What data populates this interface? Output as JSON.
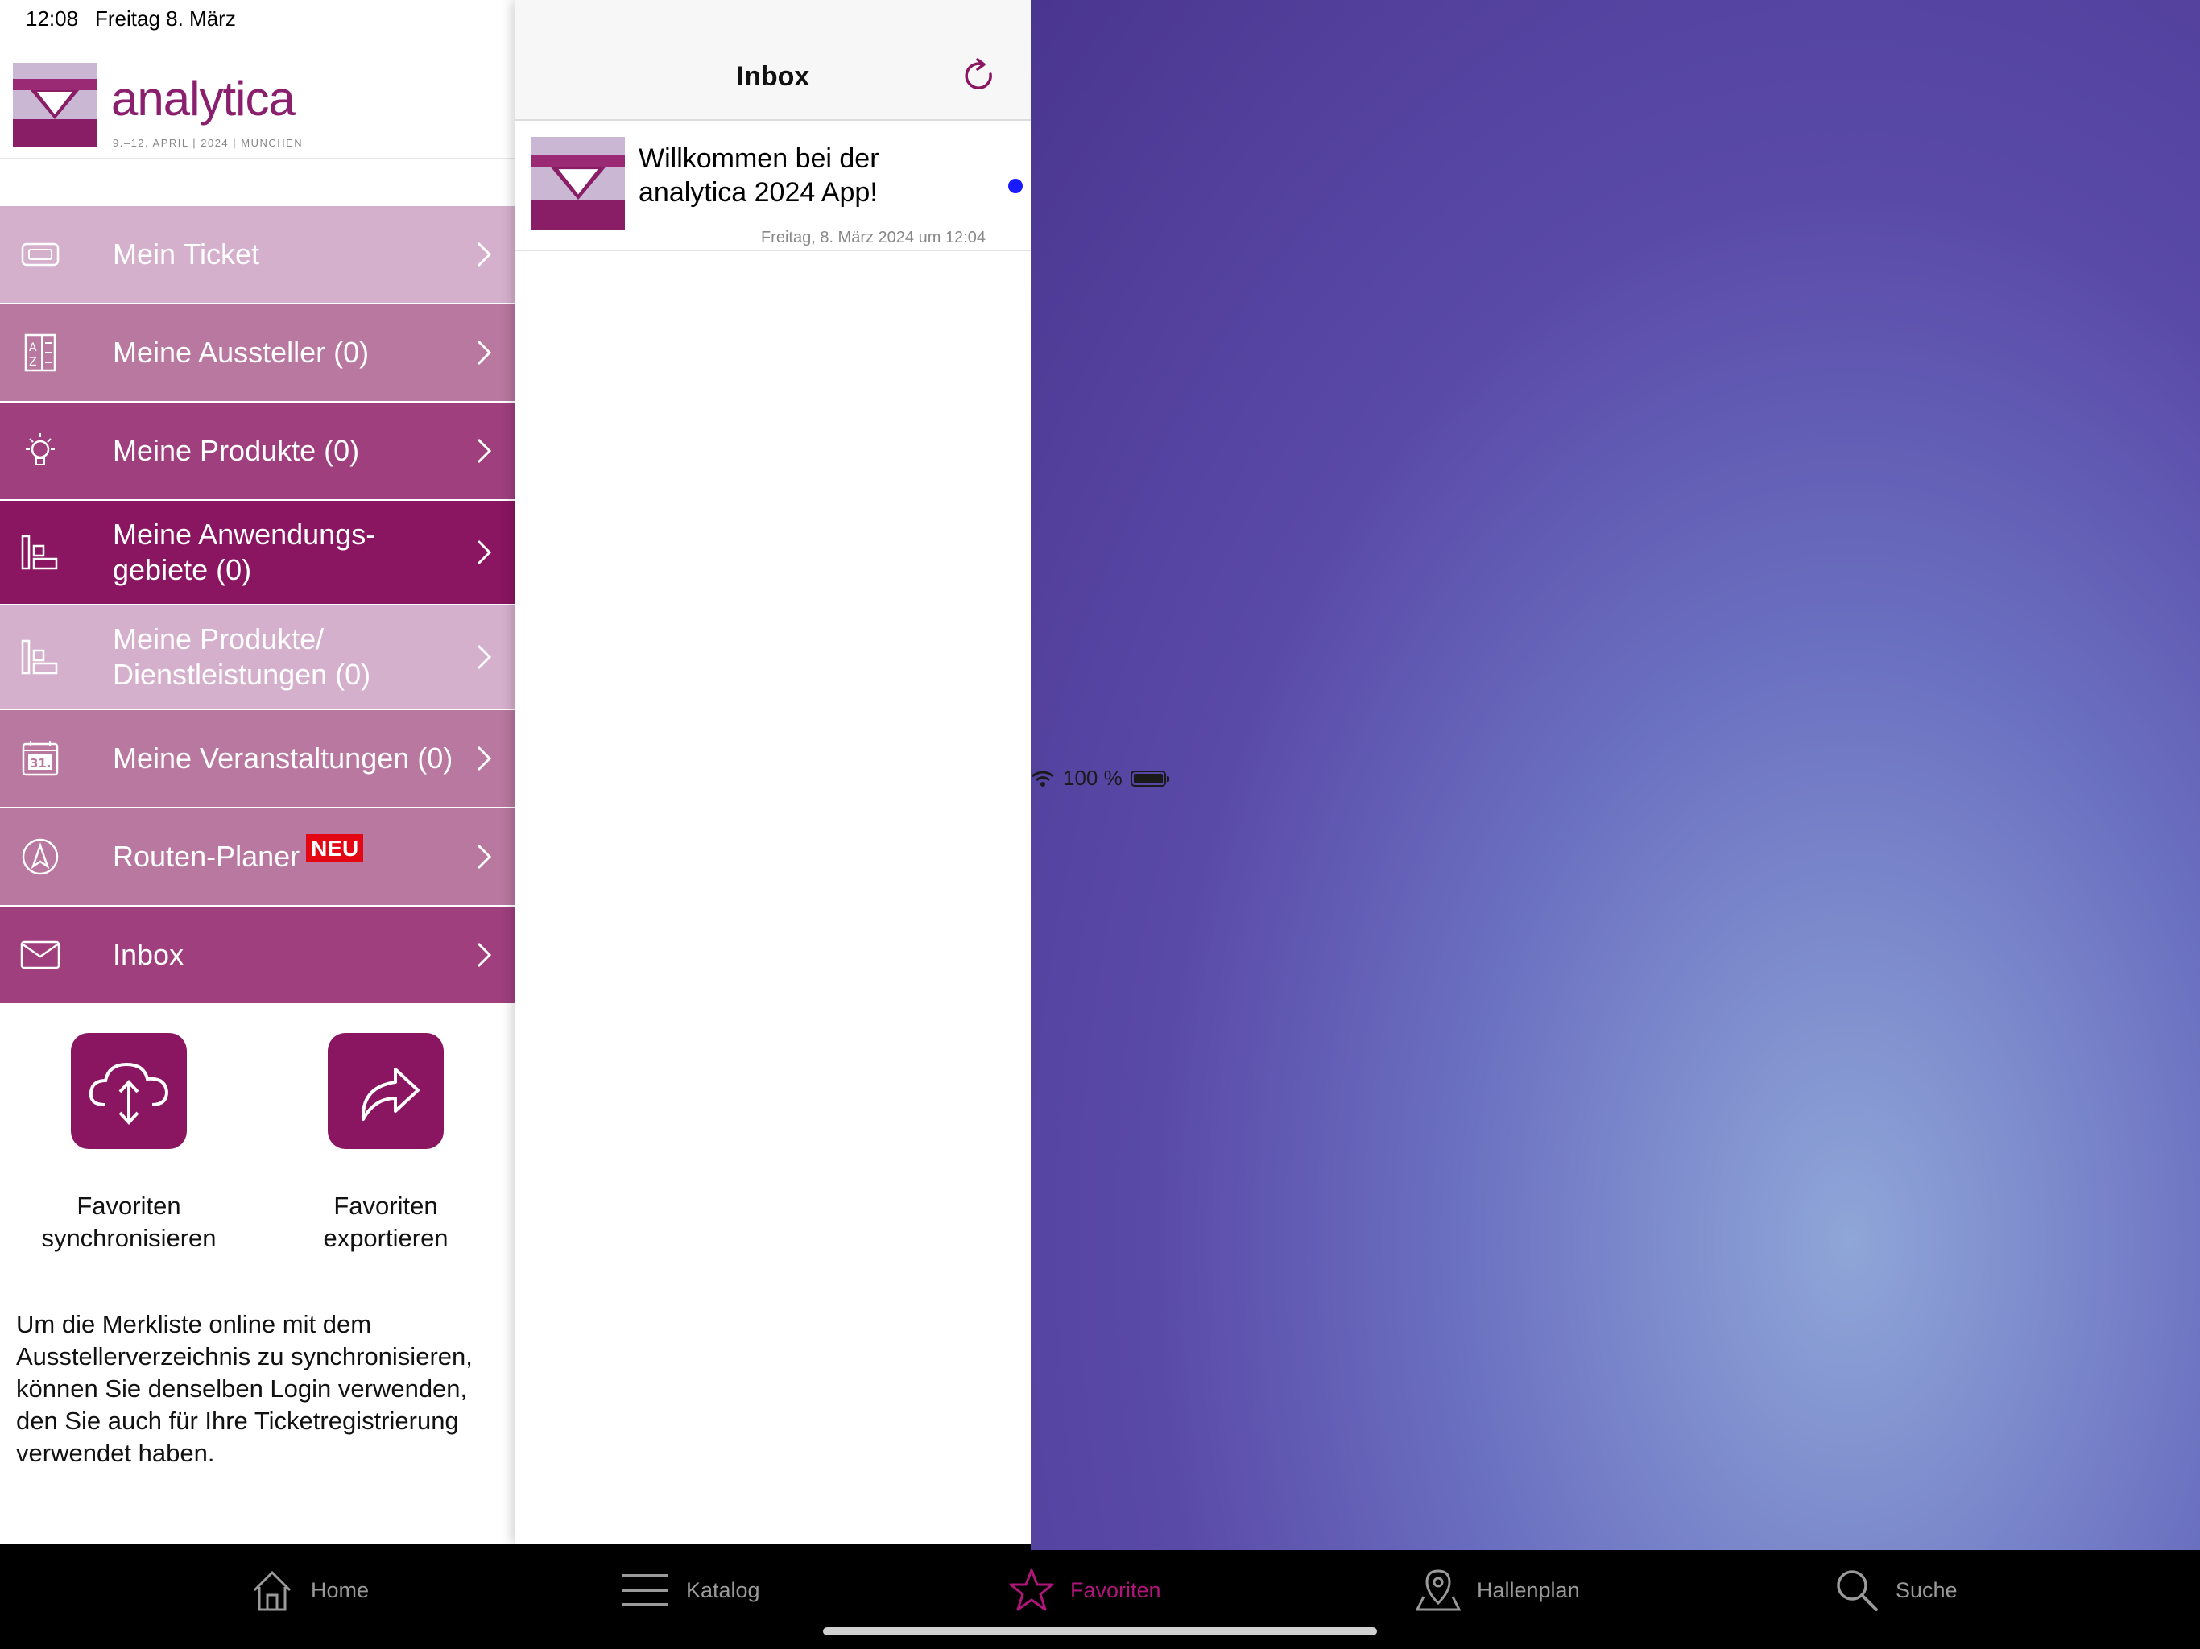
{
  "status": {
    "time": "12:08",
    "date": "Freitag 8. März",
    "battery": "100 %"
  },
  "logo": {
    "word": "analytica",
    "sub": "9.–12. APRIL | 2024 | MÜNCHEN"
  },
  "menu": [
    {
      "label": "Mein Ticket",
      "icon": "ticket-icon",
      "color": "#d5b0cc"
    },
    {
      "label": "Meine Aussteller (0)",
      "icon": "az-list-icon",
      "color": "#b9789f"
    },
    {
      "label": "Meine Produkte (0)",
      "icon": "lightbulb-icon",
      "color": "#9f3f7e"
    },
    {
      "label": "Meine Anwendungs-\ngebiete (0)",
      "icon": "bar-layout-icon",
      "color": "#8a1561"
    },
    {
      "label": "Meine Produkte/\nDienstleistungen (0)",
      "icon": "bar-layout-icon",
      "color": "#d5b0cc"
    },
    {
      "label": "Meine Veranstaltungen (0)",
      "icon": "calendar-icon",
      "color": "#b9789f"
    },
    {
      "label": "Routen-Planer",
      "badge": "NEU",
      "icon": "navigation-icon",
      "color": "#b9789f"
    },
    {
      "label": "Inbox",
      "icon": "mail-icon",
      "color": "#9f3f7e"
    }
  ],
  "favorites": {
    "sync_label": "Favoriten\nsynchronisieren",
    "export_label": "Favoriten\nexportieren",
    "info": "Um die Merkliste online mit dem Ausstellerverzeichnis zu synchronisieren, können Sie denselben Login verwenden, den Sie auch für Ihre Ticketregistrierung verwendet haben."
  },
  "inbox": {
    "title": "Inbox",
    "messages": [
      {
        "title": "Willkommen bei der analytica 2024 App!",
        "date": "Freitag, 8. März 2024 um 12:04",
        "unread": true
      }
    ]
  },
  "tabs": [
    {
      "label": "Home",
      "icon": "home-icon",
      "active": false
    },
    {
      "label": "Katalog",
      "icon": "list-icon",
      "active": false
    },
    {
      "label": "Favoriten",
      "icon": "star-icon",
      "active": true
    },
    {
      "label": "Hallenplan",
      "icon": "map-pin-icon",
      "active": false
    },
    {
      "label": "Suche",
      "icon": "search-icon",
      "active": false
    }
  ],
  "colors": {
    "brand": "#8a1560",
    "accent": "#b0167a",
    "unread_dot": "#1a1aff",
    "badge": "#e30613"
  }
}
